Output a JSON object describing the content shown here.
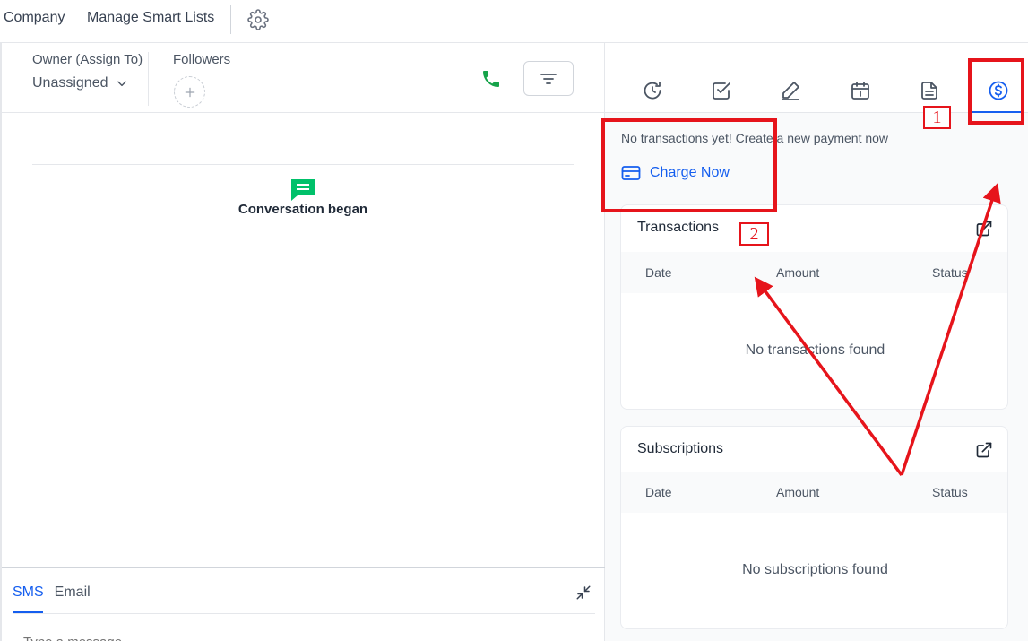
{
  "topbar": {
    "items": [
      "Company",
      "Manage Smart Lists"
    ],
    "settings_icon": "gear-icon"
  },
  "contact": {
    "owner_label": "Owner (Assign To)",
    "owner_value": "Unassigned",
    "followers_label": "Followers",
    "phone_color": "#16a34a"
  },
  "conversation": {
    "event_text": "Conversation began",
    "event_icon_color": "#00c16a"
  },
  "composer": {
    "tabs": [
      "SMS",
      "Email"
    ],
    "active_tab": "SMS",
    "placeholder": "Type a message"
  },
  "right_panel": {
    "tabs": [
      "activity-icon",
      "tasks-icon",
      "notes-icon",
      "appointments-icon",
      "documents-icon",
      "payments-icon"
    ],
    "active_tab": "payments-icon",
    "accent_color": "#155eef",
    "empty_message": "No transactions yet! Create a new payment now",
    "charge_button": "Charge Now",
    "transactions": {
      "title": "Transactions",
      "columns": [
        "Date",
        "Amount",
        "Status"
      ],
      "empty": "No transactions found"
    },
    "subscriptions": {
      "title": "Subscriptions",
      "columns": [
        "Date",
        "Amount",
        "Status"
      ],
      "empty": "No subscriptions found"
    }
  },
  "annotations": {
    "color": "#e6141b",
    "labels": [
      "1",
      "2"
    ]
  }
}
